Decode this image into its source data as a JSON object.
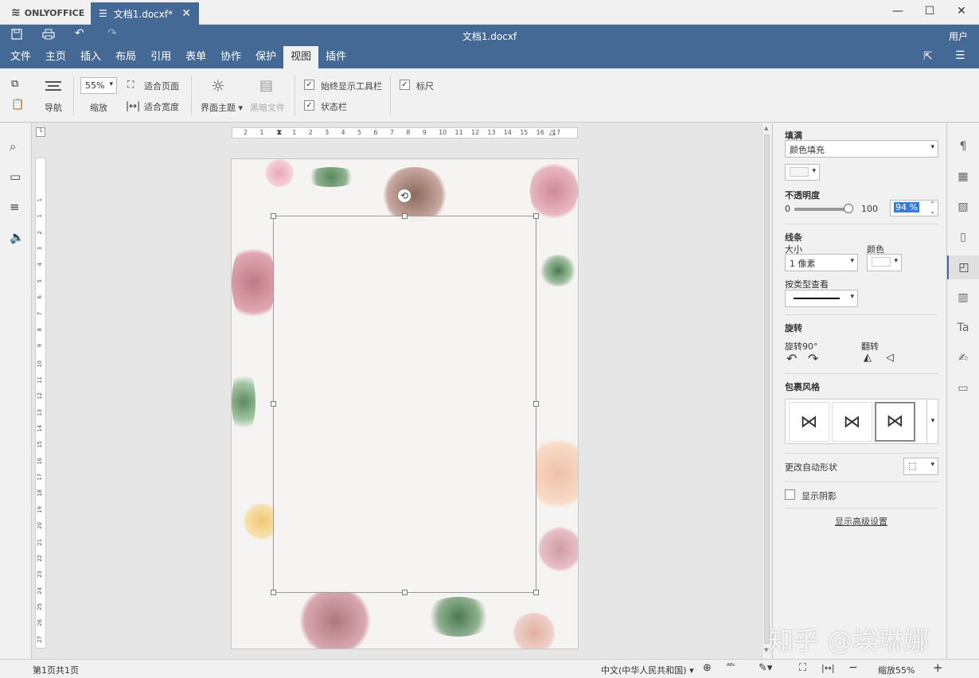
{
  "app": {
    "name": "ONLYOFFICE"
  },
  "tab": {
    "title": "文档1.docxf*"
  },
  "header": {
    "doc_title": "文档1.docxf",
    "user": "用户"
  },
  "menu": [
    "文件",
    "主页",
    "插入",
    "布局",
    "引用",
    "表单",
    "协作",
    "保护",
    "视图",
    "插件"
  ],
  "menu_active": "视图",
  "toolbar": {
    "nav_label": "导航",
    "zoom_value": "55%",
    "zoom_label": "缩放",
    "fit_page": "适合页面",
    "fit_width": "适合宽度",
    "theme_label": "界面主题",
    "dark_doc_label": "黑暗文件",
    "always_show_toolbar": "始终显示工具栏",
    "status_bar": "状态栏",
    "ruler": "标尺"
  },
  "ruler": {
    "h_ticks": [
      "2",
      "1",
      "1",
      "1",
      "2",
      "3",
      "4",
      "5",
      "6",
      "7",
      "8",
      "9",
      "10",
      "11",
      "12",
      "13",
      "14",
      "15",
      "16",
      "17"
    ],
    "v_ticks": [
      "1",
      "1",
      "2",
      "3",
      "4",
      "5",
      "6",
      "7",
      "8",
      "9",
      "10",
      "11",
      "12",
      "13",
      "14",
      "15",
      "16",
      "17",
      "18",
      "19",
      "20",
      "21",
      "22",
      "23",
      "24",
      "25",
      "26",
      "27"
    ]
  },
  "panel": {
    "fill_title": "填满",
    "fill_type": "颜色填充",
    "opacity_title": "不透明度",
    "opacity_min": "0",
    "opacity_max": "100",
    "opacity_value": "94 %",
    "opacity_fraction": 0.94,
    "stroke_title": "线条",
    "size_label": "大小",
    "color_label": "颜色",
    "size_value": "1 像素",
    "type_label": "按类型查看",
    "rotate_title": "旋转",
    "rotate90_label": "旋转90°",
    "flip_label": "翻转",
    "wrap_title": "包裹风格",
    "change_shape": "更改自动形状",
    "show_shadow": "显示阴影",
    "advanced": "显示高级设置"
  },
  "status": {
    "page_info": "第1页共1页",
    "language": "中文(中华人民共和国)",
    "zoom": "缩放55%"
  },
  "watermark": "知乎 @埃琳娜",
  "colors": {
    "brand": "#446995",
    "toolbar_bg": "#f1f1f1"
  }
}
